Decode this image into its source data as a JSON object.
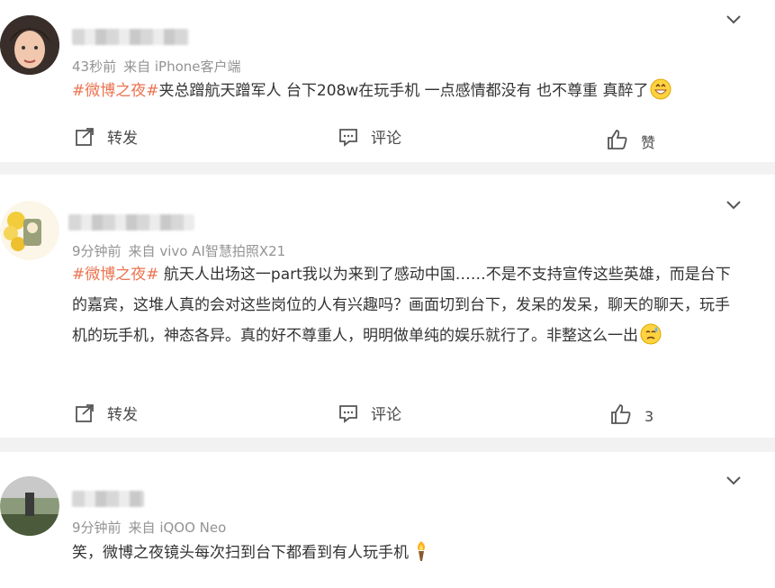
{
  "posts": [
    {
      "name": "",
      "time": "43秒前",
      "source": "来自 iPhone客户端",
      "tag": "#微博之夜#",
      "text": "夹总蹭航天蹭军人 台下208w在玩手机 一点感情都没有 也不尊重 真醉了",
      "emoji": "grinning-emoji",
      "actions": {
        "repost": "转发",
        "comment": "评论",
        "like": "赞"
      }
    },
    {
      "name": "",
      "time": "9分钟前",
      "source": "来自 vivo AI智慧拍照X21",
      "tag": "#微博之夜#",
      "text": " 航天人出场这一part我以为来到了感动中国……不是不支持宣传这些英雄，而是台下的嘉宾，这堆人真的会对这些岗位的人有兴趣吗？画面切到台下，发呆的发呆，聊天的聊天，玩手机的玩手机，神态各异。真的好不尊重人，明明做单纯的娱乐就行了。非整这么一出",
      "emoji": "sad-sweat-emoji",
      "actions": {
        "repost": "转发",
        "comment": "评论",
        "like": "3"
      }
    },
    {
      "name": "",
      "time": "9分钟前",
      "source": "来自 iQOO Neo",
      "tag": "",
      "text": "笑，微博之夜镜头每次扫到台下都看到有人玩手机",
      "emoji": "torch-emoji"
    }
  ],
  "colors": {
    "tag": "#eb7350",
    "meta": "#939393",
    "text": "#333333",
    "bg": "#f2f2f2"
  }
}
